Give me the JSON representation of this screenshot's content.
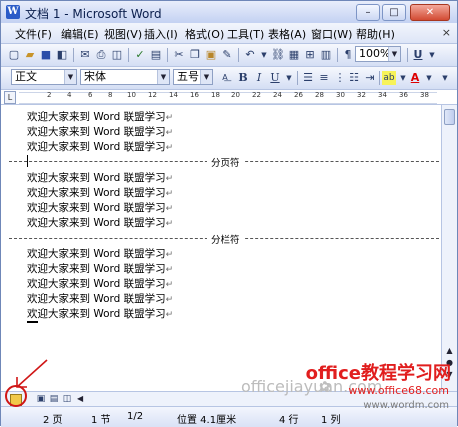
{
  "window": {
    "title": "文档 1 - Microsoft Word",
    "title_icon": "W",
    "controls": {
      "minimize": "–",
      "maximize": "□",
      "close": "✕"
    }
  },
  "menu": {
    "items": [
      "文件(F)",
      "编辑(E)",
      "视图(V)",
      "插入(I)",
      "格式(O)",
      "工具(T)",
      "表格(A)",
      "窗口(W)",
      "帮助(H)"
    ],
    "close": "×"
  },
  "toolbar_standard": {
    "icons": [
      "new-doc-icon",
      "open-icon",
      "save-icon",
      "permission-icon",
      "email-icon",
      "print-icon",
      "print-preview-icon",
      "spellcheck-icon",
      "research-icon",
      "cut-icon",
      "copy-icon",
      "paste-icon",
      "format-painter-icon",
      "undo-icon",
      "redo-icon",
      "insert-hyperlink-icon",
      "tables-borders-icon",
      "insert-table-icon",
      "show-formatting-icon",
      "read-icon"
    ],
    "zoom": "100%",
    "underline_label": "U"
  },
  "toolbar_format": {
    "style": "正文",
    "font": "宋体",
    "size": "五号",
    "bold": "B",
    "italic": "I",
    "underline": "U",
    "font_color_label": "A",
    "highlight_label": "ab"
  },
  "ruler": {
    "ticks": [
      "2",
      "4",
      "6",
      "8",
      "10",
      "12",
      "14",
      "16",
      "18",
      "20",
      "22",
      "24",
      "26",
      "28",
      "30",
      "32",
      "34",
      "36",
      "38"
    ]
  },
  "document": {
    "line_text": "欢迎大家来到 Word 联盟学习",
    "paragraph_mark": "↵",
    "page_break_label": "分页符",
    "column_break_label": "分栏符"
  },
  "statusbar": {
    "page": "2 页",
    "section": "1 节",
    "page_of": "1/2",
    "position": "位置 4.1厘米",
    "line": "4 行",
    "column": "1 列"
  },
  "watermark": {
    "brand": "office教程学习网",
    "domain_gray": "officejiayuan.com",
    "url": "www.office68.com",
    "url2": "www.wordm.com"
  },
  "colors": {
    "annotation_red": "#d01616",
    "watermark_red": "#e11e1e"
  }
}
